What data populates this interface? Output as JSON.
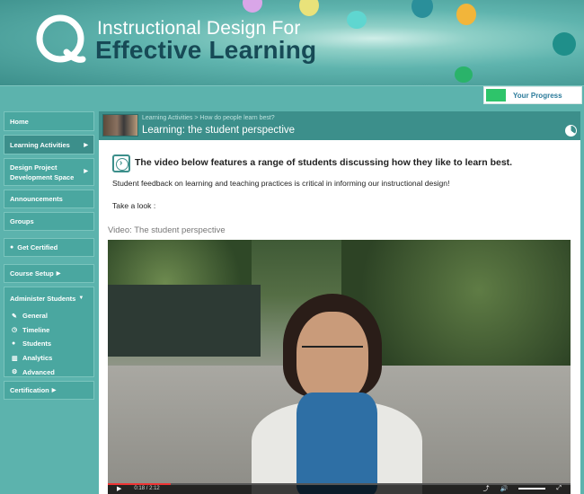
{
  "banner": {
    "title_line1": "Instructional Design For",
    "title_line2": "Effective Learning"
  },
  "progress": {
    "label": "Your Progress"
  },
  "sidebar": {
    "items": [
      {
        "label": "Home"
      },
      {
        "label": "Learning Activities"
      },
      {
        "label": "Design Project Development Space"
      },
      {
        "label": "Announcements"
      },
      {
        "label": "Groups"
      },
      {
        "label": "Get Certified"
      },
      {
        "label": "Course Setup"
      }
    ],
    "administer": {
      "label": "Administer Students",
      "items": [
        {
          "label": "General",
          "icon": "edit-icon"
        },
        {
          "label": "Timeline",
          "icon": "clock-icon"
        },
        {
          "label": "Students",
          "icon": "user-icon"
        },
        {
          "label": "Analytics",
          "icon": "chart-icon"
        },
        {
          "label": "Advanced",
          "icon": "gears-icon"
        }
      ]
    },
    "certification": {
      "label": "Certification"
    }
  },
  "content": {
    "breadcrumb": [
      "Learning Activities",
      "How do people learn best?"
    ],
    "breadcrumb_sep": ">",
    "title": "Learning: the student perspective",
    "lead": "The video below features a range of students discussing how they like to learn best.",
    "paragraph": "Student feedback on learning and teaching practices is critical in informing our instructional design!",
    "take_a_look": "Take a look :",
    "video_caption": "Video: The student perspective",
    "video": {
      "current": "0:18",
      "duration": "2:12"
    }
  },
  "colors": {
    "accent": "#3c8f8b",
    "sidebar": "#4aa7a0",
    "progress": "#2ec46a"
  }
}
